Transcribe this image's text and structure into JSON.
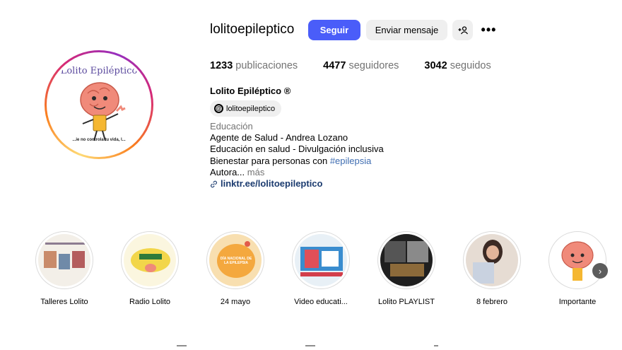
{
  "profile": {
    "username": "lolitoepileptico",
    "follow_label": "Seguir",
    "message_label": "Enviar mensaje",
    "add_user_icon": "+☺",
    "more_icon": "•••",
    "avatar_text": "Lolito Epiléptico",
    "avatar_tagline": "...ie no controla tu vida, l...",
    "stats": {
      "posts_count": "1233",
      "posts_label": "publicaciones",
      "followers_count": "4477",
      "followers_label": "seguidores",
      "following_count": "3042",
      "following_label": "seguidos"
    },
    "full_name": "Lolito Epiléptico ®",
    "threads_handle": "lolitoepileptico",
    "threads_icon": "@",
    "bio": {
      "category": "Educación",
      "line1": "Agente de Salud - Andrea Lozano",
      "line2": "Educación en salud - Divulgación inclusiva",
      "line3_prefix": "Bienestar para personas con ",
      "line3_hashtag": "#epilepsia",
      "line4": "Autora...",
      "more": "más",
      "link": "linktr.ee/lolitoepileptico",
      "link_icon": "ὑ7"
    }
  },
  "highlights": [
    {
      "label": "Talleres Lolito"
    },
    {
      "label": "Radio Lolito"
    },
    {
      "label": "24 mayo",
      "inner_text": "DÍA NACIONAL DE LA EPILEPSIA"
    },
    {
      "label": "Video educati..."
    },
    {
      "label": "Lolito PLAYLIST"
    },
    {
      "label": "8 febrero"
    },
    {
      "label": "Importante"
    }
  ],
  "next_icon": "›",
  "colors": {
    "follow_button": "#4a5df9",
    "secondary_button": "#efefef",
    "hashtag": "#3f6db1",
    "link": "#1b3b6f",
    "muted_text": "#737373"
  }
}
